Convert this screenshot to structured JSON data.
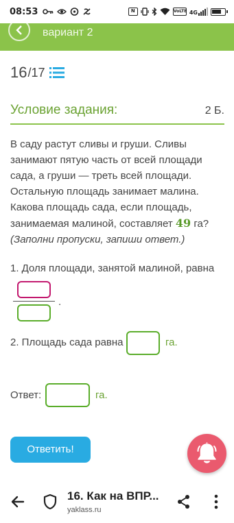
{
  "status_bar": {
    "time": "08:53",
    "left_icons": [
      "key-icon",
      "eye-icon",
      "cloud-icon",
      "no-calls-icon"
    ],
    "right_icons": [
      "nfc-icon",
      "vibrate-icon",
      "bluetooth-icon",
      "wifi-icon",
      "volte-icon",
      "4g-signal-icon",
      "battery-icon"
    ],
    "volte_label": "VoLTE",
    "net_label": "4G"
  },
  "header": {
    "title": "вариант 2",
    "color": "#8bc34a"
  },
  "counter": {
    "current": "16",
    "separator": "/17"
  },
  "condition": {
    "title": "Условие задания:",
    "points": "2 Б."
  },
  "task": {
    "text_before": "В саду растут сливы и груши. Сливы занимают пятую часть от всей площади сада, а груши — треть всей площади. Остальную площадь занимает малина. Какова площадь сада, если площадь, занимаемая малиной, составляет ",
    "number": "49",
    "unit": " га?",
    "hint": "(Заполни пропуски, запиши ответ.)"
  },
  "q1": {
    "text": "1. Доля площади, занятой малиной, равна",
    "dot": "."
  },
  "q2": {
    "text": "2. Площадь сада равна",
    "unit": "га."
  },
  "answer": {
    "label": "Ответ:",
    "unit": "га."
  },
  "submit": {
    "label": "Ответить!",
    "color": "#29abe2"
  },
  "bell": {
    "icon": "bell-icon",
    "color": "#ea5a6e"
  },
  "browser": {
    "title": "16. Как на ВПР...",
    "domain": "yaklass.ru"
  }
}
